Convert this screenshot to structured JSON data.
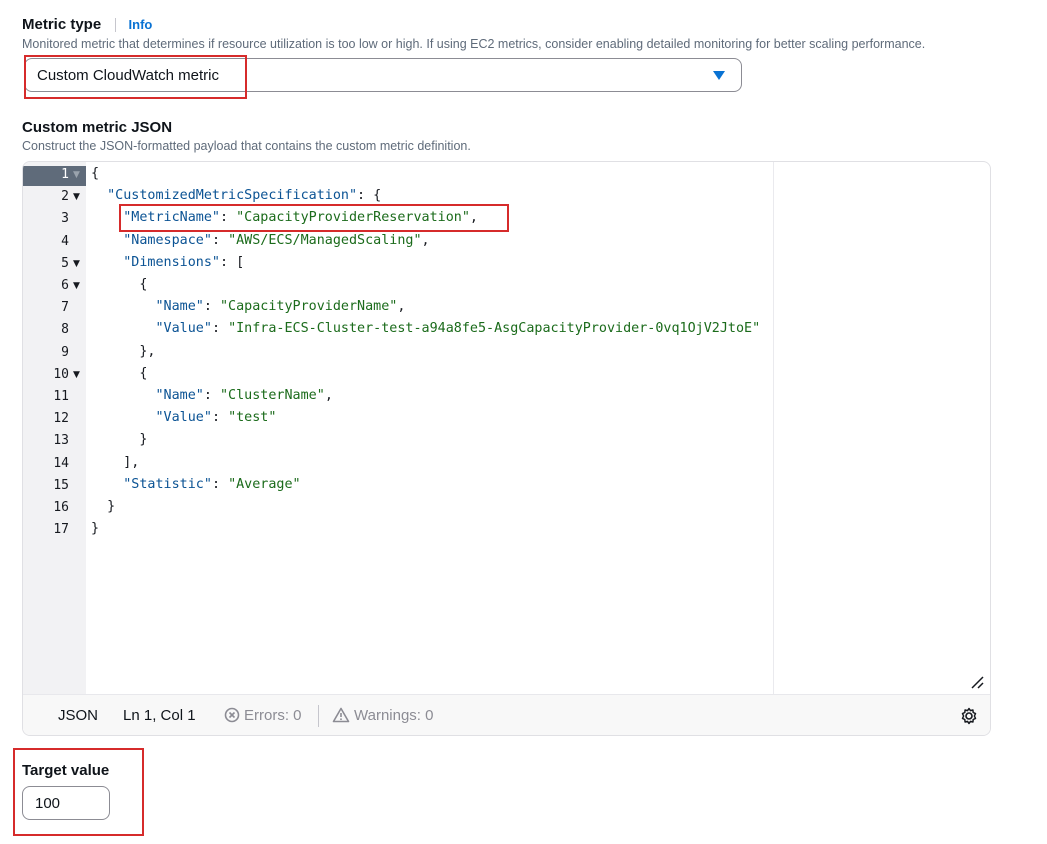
{
  "metric_type": {
    "label": "Metric type",
    "info_link": "Info",
    "description": "Monitored metric that determines if resource utilization is too low or high. If using EC2 metrics, consider enabling detailed monitoring for better scaling performance.",
    "selected": "Custom CloudWatch metric"
  },
  "custom_metric": {
    "label": "Custom metric JSON",
    "description": "Construct the JSON-formatted payload that contains the custom metric definition."
  },
  "editor": {
    "lines": [
      "{",
      "  \"CustomizedMetricSpecification\": {",
      "    \"MetricName\": \"CapacityProviderReservation\",",
      "    \"Namespace\": \"AWS/ECS/ManagedScaling\",",
      "    \"Dimensions\": [",
      "      {",
      "        \"Name\": \"CapacityProviderName\",",
      "        \"Value\": \"Infra-ECS-Cluster-test-a94a8fe5-AsgCapacityProvider-0vq1OjV2JtoE\"",
      "      },",
      "      {",
      "        \"Name\": \"ClusterName\",",
      "        \"Value\": \"test\"",
      "      }",
      "    ],",
      "    \"Statistic\": \"Average\"",
      "  }",
      "}"
    ],
    "line_numbers": [
      "1",
      "2",
      "3",
      "4",
      "5",
      "6",
      "7",
      "8",
      "9",
      "10",
      "11",
      "12",
      "13",
      "14",
      "15",
      "16",
      "17"
    ],
    "fold_lines": [
      1,
      2,
      5,
      6,
      10
    ],
    "status": {
      "language": "JSON",
      "cursor": "Ln 1, Col 1",
      "errors": "Errors: 0",
      "warnings": "Warnings: 0"
    }
  },
  "target_value": {
    "label": "Target value",
    "value": "100"
  },
  "colors": {
    "accent": "#0972d3",
    "highlight": "#d62b2b",
    "json_key": "#0b5394",
    "json_string": "#1b6b1b"
  }
}
